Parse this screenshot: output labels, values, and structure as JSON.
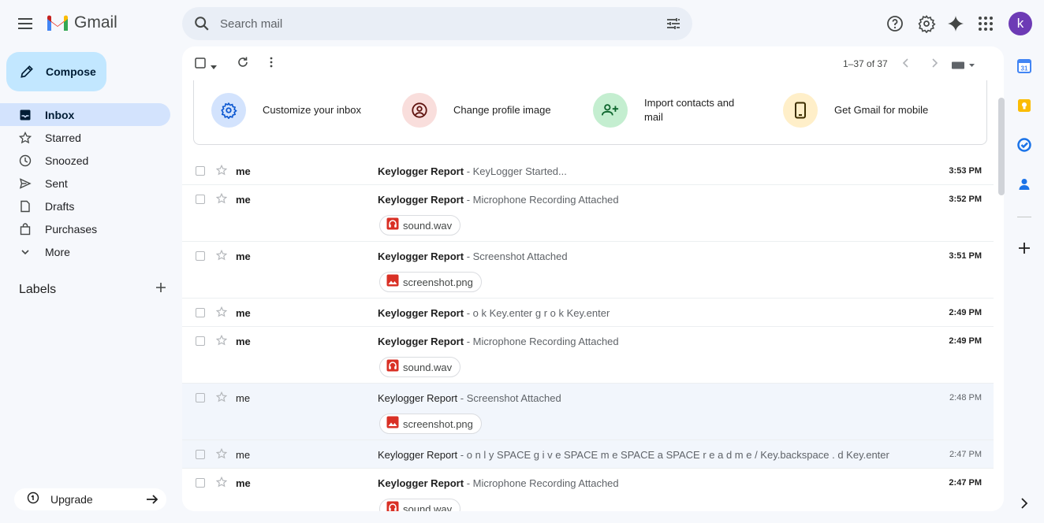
{
  "app": {
    "name": "Gmail"
  },
  "search": {
    "placeholder": "Search mail"
  },
  "sidebar": {
    "compose_label": "Compose",
    "items": [
      {
        "label": "Inbox",
        "icon": "inbox-icon",
        "active": true
      },
      {
        "label": "Starred",
        "icon": "star-icon"
      },
      {
        "label": "Snoozed",
        "icon": "clock-icon"
      },
      {
        "label": "Sent",
        "icon": "send-icon"
      },
      {
        "label": "Drafts",
        "icon": "draft-icon"
      },
      {
        "label": "Purchases",
        "icon": "bag-icon"
      },
      {
        "label": "More",
        "icon": "chevron-down-icon"
      }
    ],
    "labels_heading": "Labels",
    "upgrade_label": "Upgrade"
  },
  "user": {
    "avatar_letter": "k",
    "avatar_color": "#6d3bb5"
  },
  "toolbar": {
    "pager": "1–37 of 37"
  },
  "promo": [
    {
      "label": "Customize your inbox",
      "icon": "gear-icon"
    },
    {
      "label": "Change profile image",
      "icon": "account-circle-icon"
    },
    {
      "label": "Import contacts and mail",
      "icon": "person-add-icon"
    },
    {
      "label": "Get Gmail for mobile",
      "icon": "phone-icon"
    }
  ],
  "emails": [
    {
      "sender": "me",
      "subject": "Keylogger Report",
      "snippet": " - KeyLogger Started...",
      "time": "3:53 PM",
      "unread": true
    },
    {
      "sender": "me",
      "subject": "Keylogger Report",
      "snippet": " - Microphone Recording Attached",
      "time": "3:52 PM",
      "unread": true,
      "attachment": "sound.wav",
      "att_type": "audio"
    },
    {
      "sender": "me",
      "subject": "Keylogger Report",
      "snippet": " - Screenshot Attached",
      "time": "3:51 PM",
      "unread": true,
      "attachment": "screenshot.png",
      "att_type": "image"
    },
    {
      "sender": "me",
      "subject": "Keylogger Report",
      "snippet": " - o k Key.enter g r o k Key.enter",
      "time": "2:49 PM",
      "unread": true
    },
    {
      "sender": "me",
      "subject": "Keylogger Report",
      "snippet": " - Microphone Recording Attached",
      "time": "2:49 PM",
      "unread": true,
      "attachment": "sound.wav",
      "att_type": "audio"
    },
    {
      "sender": "me",
      "subject": "Keylogger Report",
      "snippet": " - Screenshot Attached",
      "time": "2:48 PM",
      "unread": false,
      "attachment": "screenshot.png",
      "att_type": "image"
    },
    {
      "sender": "me",
      "subject": "Keylogger Report",
      "snippet": " - o n l y SPACE g i v e SPACE m e SPACE a SPACE r e a d m e / Key.backspace . d Key.enter",
      "time": "2:47 PM",
      "unread": false
    },
    {
      "sender": "me",
      "subject": "Keylogger Report",
      "snippet": " - Microphone Recording Attached",
      "time": "2:47 PM",
      "unread": true,
      "attachment": "sound.wav",
      "att_type": "audio"
    }
  ]
}
